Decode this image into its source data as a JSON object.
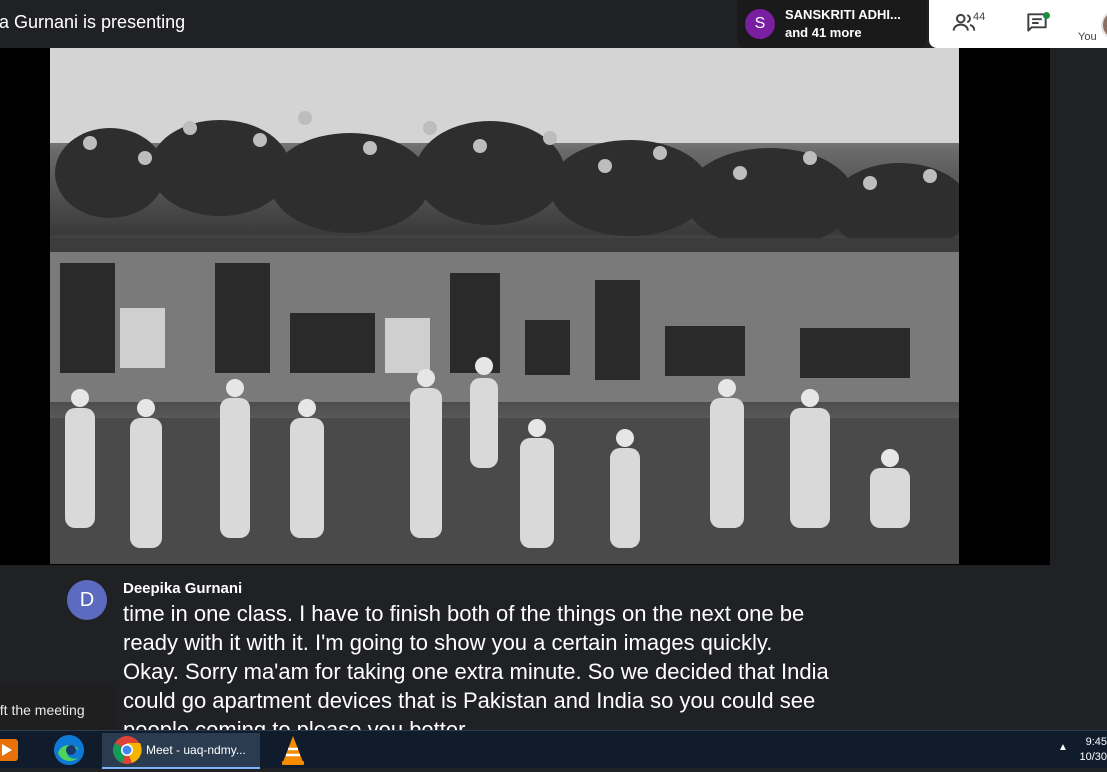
{
  "meeting": {
    "presenting_text": "ta Gurnani is presenting"
  },
  "participants": {
    "avatar_letter": "S",
    "avatar_color": "#7b1fa2",
    "first_name": "SANSKRITI ADHI...",
    "more_text": "and 41 more"
  },
  "controls": {
    "people_icon": "people-icon",
    "people_count": "44",
    "chat_icon": "chat-icon",
    "you_label": "You"
  },
  "presentation": {
    "image_subject": "historical black and white photograph"
  },
  "captions": {
    "speaker_initial": "D",
    "speaker_name": "Deepika Gurnani",
    "text": "time in one class. I have to finish both of the things on the next one be\nready with it with it. I'm going to show you a certain images quickly.\nOkay. Sorry ma'am for taking one extra minute. So we decided that India\ncould go apartment devices that is Pakistan and India so you could see\npeople coming to please you better"
  },
  "notification": {
    "text": "eft the meeting"
  },
  "taskbar": {
    "apps": [
      {
        "name": "media-player",
        "icon": "play-icon"
      },
      {
        "name": "edge",
        "icon": "edge-icon"
      },
      {
        "name": "chrome",
        "icon": "chrome-icon",
        "label": "Meet - uaq-ndmy..."
      },
      {
        "name": "vlc",
        "icon": "vlc-icon"
      }
    ],
    "chrome_label": "Meet - uaq-ndmy...",
    "time": "9:45",
    "date": "10/30"
  },
  "colors": {
    "meet_background": "#202124",
    "taskbar": "#101c2c",
    "caption_avatar": "#5c6bc0",
    "chat_notification_dot": "#1e8e3e"
  }
}
